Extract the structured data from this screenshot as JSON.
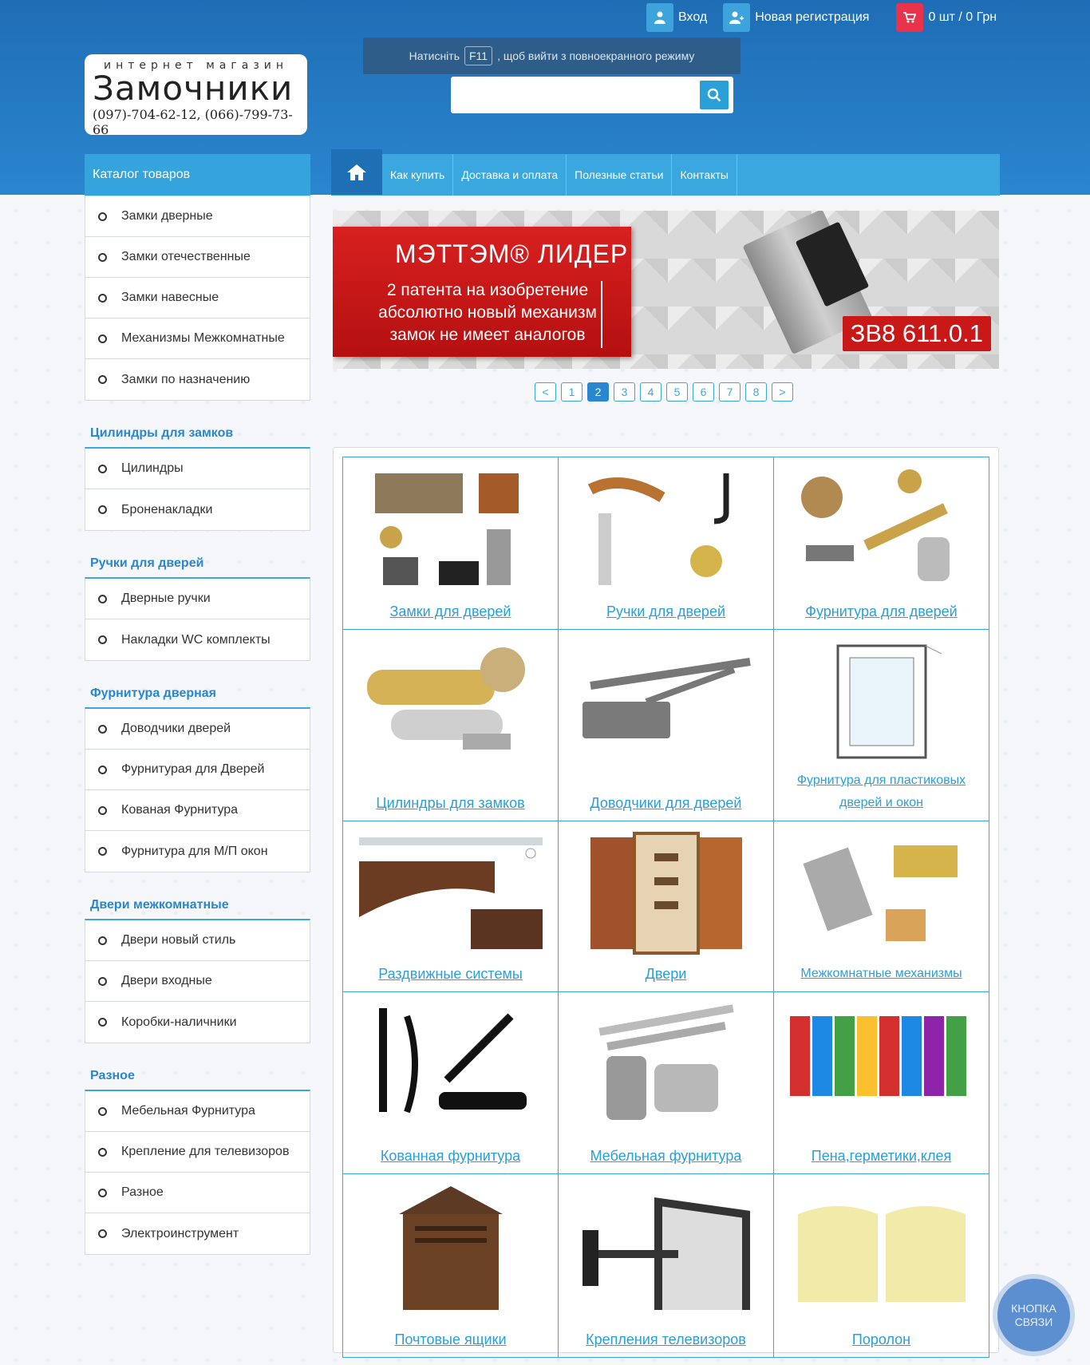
{
  "topbar": {
    "login": "Вход",
    "register": "Новая регистрация",
    "cart": "0 шт / 0 Грн"
  },
  "logo": {
    "subtitle": "интернет магазин",
    "name": "Замочники",
    "phones": "(097)-704-62-12, (066)-799-73-66"
  },
  "fullscreen_hint": {
    "before": "Натисніть",
    "key": "F11",
    "after": ", щоб вийти з повноекранного режиму"
  },
  "search": {
    "placeholder": ""
  },
  "catalog_head": "Каталог товаров",
  "nav": [
    "Как купить",
    "Доставка и оплата",
    "Полезные статьи",
    "Контакты"
  ],
  "sidebar": {
    "groups": [
      {
        "title": "",
        "items": [
          "Замки дверные",
          "Замки отечественные",
          "Замки навесные",
          "Механизмы Межкомнатные",
          "Замки по назначению"
        ]
      },
      {
        "title": "Цилиндры для замков",
        "items": [
          "Цилиндры",
          "Броненакладки"
        ]
      },
      {
        "title": "Ручки для дверей",
        "items": [
          "Дверные ручки",
          "Накладки WC комплекты"
        ]
      },
      {
        "title": "Фурнитура дверная",
        "items": [
          "Доводчики дверей",
          "Фурнитурая для Дверей",
          "Кованая Фурнитура",
          "Фурнитура для М/П окон"
        ]
      },
      {
        "title": "Двери межкомнатные",
        "items": [
          "Двери новый стиль",
          "Двери входные",
          "Коробки-наличники"
        ]
      },
      {
        "title": "Разное",
        "items": [
          "Мебельная Фурнитура",
          "Крепление для телевизоров",
          "Разное",
          "Электроинструмент"
        ]
      }
    ]
  },
  "banner": {
    "title": "МЭТТЭМ® ЛИДЕР",
    "lines": [
      "2 патента на изобретение",
      "абсолютно новый механизм",
      "замок не имеет аналогов"
    ],
    "model": "ЗВ8 611.0.1"
  },
  "pager": {
    "prev": "<",
    "next": ">",
    "pages": [
      "1",
      "2",
      "3",
      "4",
      "5",
      "6",
      "7",
      "8"
    ],
    "active": "2"
  },
  "products": [
    "Замки для дверей",
    "Ручки для дверей",
    "Фурнитура для дверей",
    "Цилиндры для замков",
    "Доводчики для дверей",
    "Фурнитура для пластиковых дверей и окон",
    "Раздвижные системы",
    "Двери",
    "Межкомнатные механизмы",
    "Кованная фурнитура",
    "Мебельная фурнитура",
    "Пена,герметики,клея",
    "Почтовые ящики",
    "Крепления телевизоров",
    "Поролон"
  ],
  "contact_button": "КНОПКА СВЯЗИ",
  "colors": {
    "header_blue": "#1f6db5",
    "accent_blue": "#3aa7de",
    "cart_red": "#e8334a",
    "banner_red": "#c81818"
  }
}
